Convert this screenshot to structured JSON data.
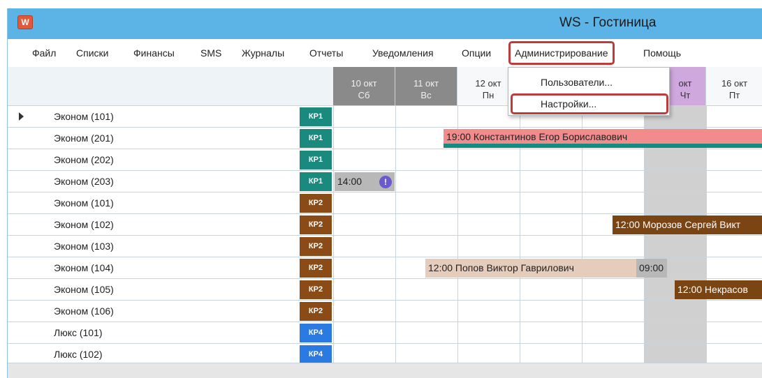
{
  "window": {
    "icon_glyph": "W",
    "title": "WS - Гостиница"
  },
  "menu": [
    {
      "label": "Файл"
    },
    {
      "label": "Списки"
    },
    {
      "label": "Финансы"
    },
    {
      "label": "SMS"
    },
    {
      "label": "Журналы"
    },
    {
      "label": "Отчеты"
    },
    {
      "label": "Уведомления"
    },
    {
      "label": "Опции"
    },
    {
      "label": "Администрирование",
      "highlighted": true
    },
    {
      "label": "Помощь"
    }
  ],
  "admin_dropdown": {
    "items": [
      {
        "label": "Пользователи..."
      },
      {
        "label": "Настройки...",
        "highlighted": true
      }
    ]
  },
  "days": [
    {
      "date": "10 окт",
      "weekday": "Сб",
      "weekend": true
    },
    {
      "date": "11 окт",
      "weekday": "Вс",
      "weekend": true
    },
    {
      "date": "12 окт",
      "weekday": "Пн"
    },
    {
      "date": "",
      "weekday": ""
    },
    {
      "date": "",
      "weekday": ""
    },
    {
      "date": "окт",
      "weekday": "Чт",
      "today": true
    },
    {
      "date": "16 окт",
      "weekday": "Пт"
    }
  ],
  "rooms": [
    {
      "name": "Эконом (101)",
      "category": "КР1",
      "badge_color": "#1a8a7e",
      "selected": true
    },
    {
      "name": "Эконом (201)",
      "category": "КР1",
      "badge_color": "#1a8a7e"
    },
    {
      "name": "Эконом (202)",
      "category": "КР1",
      "badge_color": "#1a8a7e"
    },
    {
      "name": "Эконом (203)",
      "category": "КР1",
      "badge_color": "#1a8a7e"
    },
    {
      "name": "Эконом (101)",
      "category": "КР2",
      "badge_color": "#8a4b16"
    },
    {
      "name": "Эконом (102)",
      "category": "КР2",
      "badge_color": "#8a4b16"
    },
    {
      "name": "Эконом (103)",
      "category": "КР2",
      "badge_color": "#8a4b16"
    },
    {
      "name": "Эконом (104)",
      "category": "КР2",
      "badge_color": "#8a4b16"
    },
    {
      "name": "Эконом (105)",
      "category": "КР2",
      "badge_color": "#8a4b16"
    },
    {
      "name": "Эконом (106)",
      "category": "КР2",
      "badge_color": "#8a4b16"
    },
    {
      "name": "Люкс (101)",
      "category": "КР4",
      "badge_color": "#2a7ae2"
    },
    {
      "name": "Люкс (102)",
      "category": "КР4",
      "badge_color": "#2a7ae2"
    }
  ],
  "bookings": [
    {
      "text": "19:00 Константинов Егор Бориславович"
    },
    {
      "text": "14:00"
    },
    {
      "text": "12:00 Морозов Сергей Викт"
    },
    {
      "text": "12:00 Попов Виктор Гаврилович"
    },
    {
      "text": "09:00"
    },
    {
      "text": "12:00 Некрасов"
    }
  ],
  "colors": {
    "titlebar": "#5cb3e6",
    "highlight_border": "#c0393b",
    "booking_red": "#f28b8b",
    "booking_teal": "#148b80",
    "booking_brown": "#7a4413",
    "booking_tan": "#e6cdbb",
    "booking_gray": "#b8b8b8",
    "alert": "#6a5acd"
  }
}
